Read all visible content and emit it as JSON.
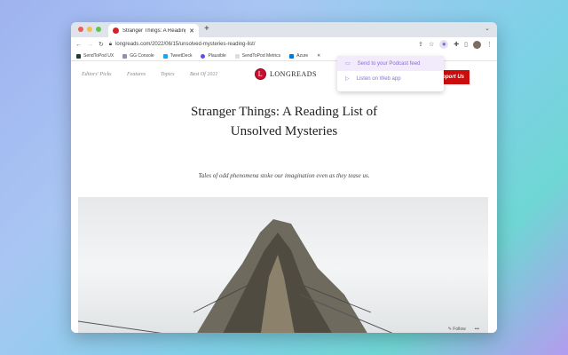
{
  "browser": {
    "tab_title": "Stranger Things: A Reading List | ...",
    "url": "longreads.com/2022/06/15/unsolved-mysteries-reading-list/",
    "bookmarks": [
      "SendToPod UX",
      "GG Console",
      "TweetDeck",
      "Plausible",
      "SendToPod Metrics",
      "Azure"
    ]
  },
  "popup": {
    "items": [
      "Send to your Podcast feed",
      "Listen on Web app"
    ]
  },
  "site": {
    "nav": [
      "Editors' Picks",
      "Features",
      "Topics",
      "Best Of 2021"
    ],
    "logo": "LONGREADS",
    "support": "Support Us"
  },
  "article": {
    "title": "Stranger Things: A Reading List of Unsolved Mysteries",
    "subtitle": "Tales of odd phenomena stoke our imagination even as they tease us."
  },
  "footer": {
    "follow": "Follow",
    "more": "•••"
  }
}
